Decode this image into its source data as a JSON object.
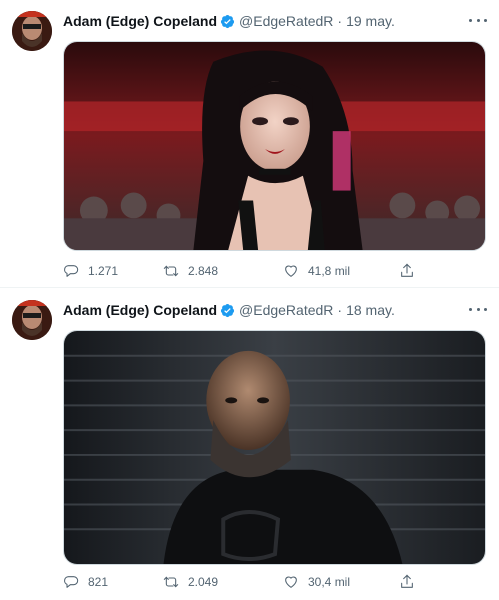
{
  "tweets": [
    {
      "author": {
        "name": "Adam (Edge) Copeland",
        "handle": "@EdgeRatedR",
        "verified": true,
        "avatar_icon": "profile-avatar-bearded-man"
      },
      "separator": "·",
      "date": "19 may.",
      "media_description_icon": "photo-woman-dark-hair-arena",
      "stats": {
        "replies": "1.271",
        "retweets": "2.848",
        "likes": "41,8 mil"
      }
    },
    {
      "author": {
        "name": "Adam (Edge) Copeland",
        "handle": "@EdgeRatedR",
        "verified": true,
        "avatar_icon": "profile-avatar-bearded-man"
      },
      "separator": "·",
      "date": "18 may.",
      "media_description_icon": "photo-bearded-wrestler-dark-stage",
      "stats": {
        "replies": "821",
        "retweets": "2.049",
        "likes": "30,4 mil"
      }
    }
  ],
  "colors": {
    "verified_badge": "#1d9bf0",
    "secondary_text": "#536471",
    "primary_text": "#0f1419"
  },
  "icons": {
    "reply": "reply-icon",
    "retweet": "retweet-icon",
    "like": "heart-icon",
    "share": "share-icon",
    "more": "more-options-icon"
  }
}
